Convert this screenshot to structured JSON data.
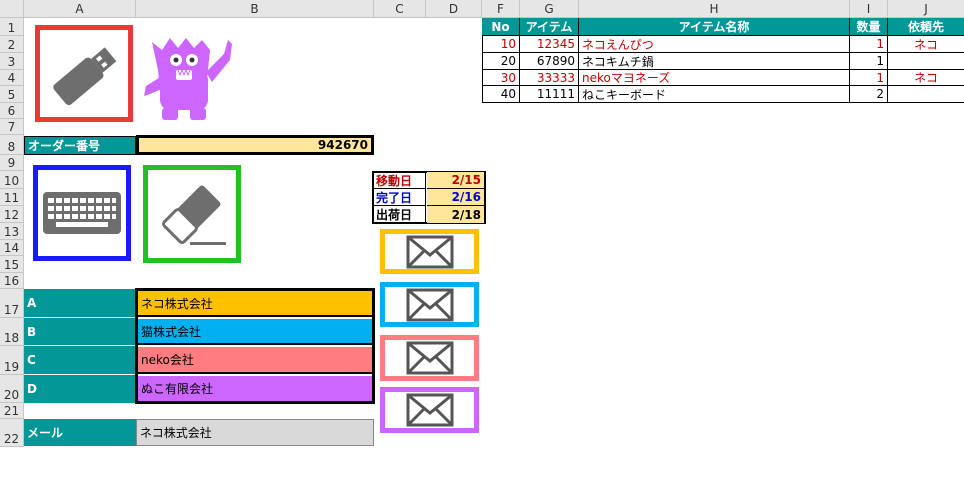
{
  "columns": [
    "A",
    "B",
    "C",
    "D",
    "F",
    "G",
    "H",
    "I",
    "J"
  ],
  "rows": [
    "1",
    "2",
    "3",
    "4",
    "5",
    "6",
    "7",
    "8",
    "9",
    "10",
    "11",
    "12",
    "13",
    "14",
    "15",
    "16",
    "17",
    "18",
    "19",
    "20",
    "21",
    "22"
  ],
  "order": {
    "label": "オーダー番号",
    "value": "942670"
  },
  "dates": [
    {
      "label": "移動日",
      "value": "2/15",
      "label_color": "#c00000",
      "value_color": "#c00000"
    },
    {
      "label": "完了日",
      "value": "2/16",
      "label_color": "#0000cc",
      "value_color": "#0000cc"
    },
    {
      "label": "出荷日",
      "value": "2/18",
      "label_color": "#000000",
      "value_color": "#000000"
    }
  ],
  "companies": [
    {
      "key": "A",
      "name": "ネコ株式会社",
      "color": "#ffc000"
    },
    {
      "key": "B",
      "name": "猫株式会社",
      "color": "#00b0f0"
    },
    {
      "key": "C",
      "name": "neko会社",
      "color": "#ff7c80"
    },
    {
      "key": "D",
      "name": "ぬこ有限会社",
      "color": "#cc66ff"
    }
  ],
  "mail": {
    "label": "メール",
    "value": "ネコ株式会社"
  },
  "table": {
    "headers": [
      "No",
      "アイテム",
      "アイテム名称",
      "数量",
      "依頼先"
    ],
    "rows": [
      {
        "no": "10",
        "item": "12345",
        "name": "ネコえんぴつ",
        "qty": "1",
        "req": "ネコ",
        "red": true
      },
      {
        "no": "20",
        "item": "67890",
        "name": "ネコキムチ鍋",
        "qty": "1",
        "req": "",
        "red": false
      },
      {
        "no": "30",
        "item": "33333",
        "name": "nekoマヨネーズ",
        "qty": "1",
        "req": "ネコ",
        "red": true
      },
      {
        "no": "40",
        "item": "11111",
        "name": "ねこキーボード",
        "qty": "2",
        "req": "",
        "red": false
      }
    ]
  },
  "icons": {
    "usb": "usb-drive-icon",
    "monster": "monster-icon",
    "keyboard": "keyboard-icon",
    "eraser": "eraser-icon",
    "envelope": "envelope-icon"
  },
  "colors": {
    "teal": "#049797",
    "usb_frame": "#e83a3a",
    "keyboard_frame": "#1a1aff",
    "eraser_frame": "#22c222",
    "monster": "#cc66ff",
    "icon_gray": "#6e6e6e",
    "order_value_bg": "#ffe699",
    "mail_value_bg": "#d9d9d9"
  }
}
